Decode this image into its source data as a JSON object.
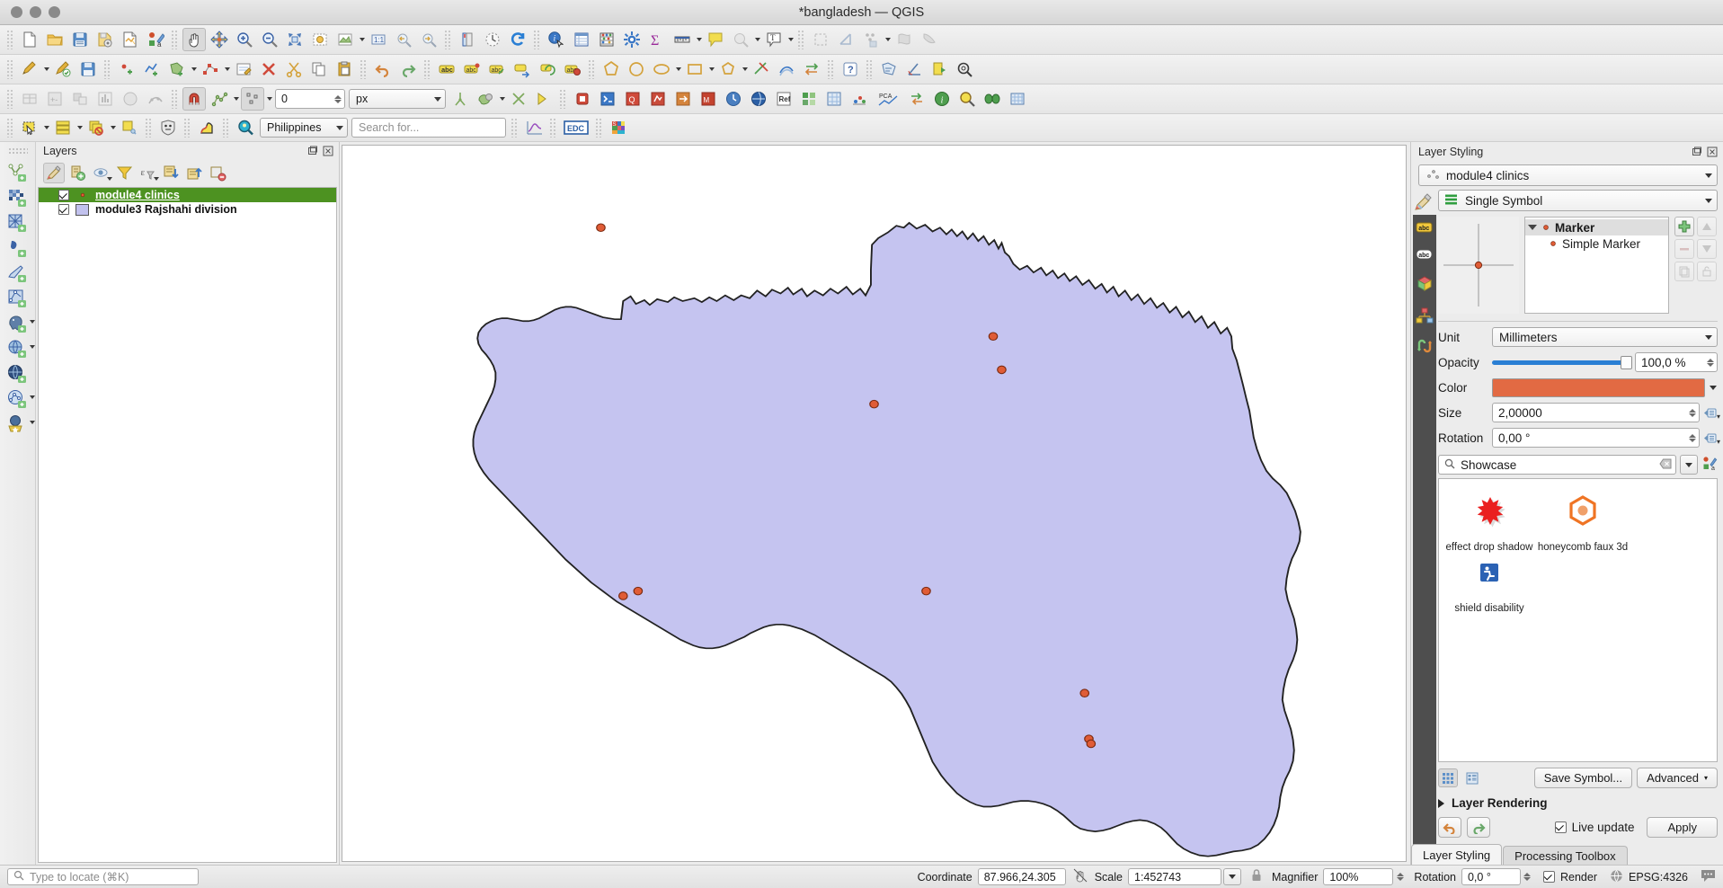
{
  "window": {
    "title": "*bangladesh — QGIS"
  },
  "toolbars": {
    "row1": [
      {
        "name": "new-project-button",
        "icon": "new-file-icon"
      },
      {
        "name": "open-project-button",
        "icon": "open-folder-icon"
      },
      {
        "name": "save-project-button",
        "icon": "save-disk-icon"
      },
      {
        "name": "save-project-as-button",
        "icon": "save-as-icon"
      },
      {
        "name": "new-print-layout-button",
        "icon": "layout-icon"
      },
      {
        "name": "style-manager-button",
        "icon": "style-manager-icon"
      },
      {
        "name": "pan-map-button",
        "icon": "pan-hand-icon"
      },
      {
        "name": "pan-to-selection-button",
        "icon": "pan-selection-icon"
      },
      {
        "name": "zoom-in-button",
        "icon": "zoom-in-icon"
      },
      {
        "name": "zoom-out-button",
        "icon": "zoom-out-icon"
      },
      {
        "name": "zoom-full-button",
        "icon": "zoom-full-icon"
      },
      {
        "name": "zoom-to-selection-button",
        "icon": "zoom-selection-icon"
      },
      {
        "name": "zoom-to-layer-button",
        "icon": "zoom-layer-icon"
      },
      {
        "name": "zoom-native-button",
        "icon": "zoom-native-icon"
      },
      {
        "name": "zoom-last-button",
        "icon": "zoom-last-icon"
      },
      {
        "name": "zoom-next-button",
        "icon": "zoom-next-icon"
      },
      {
        "name": "new-map-view-button",
        "icon": "map-view-icon"
      },
      {
        "name": "new-3d-map-view-button",
        "icon": "map-3d-icon"
      },
      {
        "name": "refresh-button",
        "icon": "refresh-icon"
      },
      {
        "name": "identify-features-button",
        "icon": "identify-icon"
      },
      {
        "name": "open-attribute-table-button",
        "icon": "attribute-table-icon"
      },
      {
        "name": "field-calculator-button",
        "icon": "abacus-icon"
      },
      {
        "name": "processing-button",
        "icon": "gear-icon"
      },
      {
        "name": "statistical-summary-button",
        "icon": "sigma-icon"
      },
      {
        "name": "measure-line-button",
        "icon": "ruler-icon"
      },
      {
        "name": "map-tips-button",
        "icon": "maptips-icon"
      },
      {
        "name": "show-pinned-labels-button",
        "icon": "pinned-labels-icon"
      },
      {
        "name": "new-text-annotation-button",
        "icon": "text-annotation-icon"
      },
      {
        "name": "select-features-button",
        "icon": "select-dashed-icon"
      },
      {
        "name": "deselect-button",
        "icon": "deselect-icon"
      },
      {
        "name": "select-by-value-button",
        "icon": "select-value-icon"
      },
      {
        "name": "select-by-expression-button",
        "icon": "select-expression-icon"
      },
      {
        "name": "invert-selection-button",
        "icon": "invert-selection-icon"
      }
    ],
    "row2": [
      {
        "name": "current-edits-button",
        "icon": "pencil-edits-icon"
      },
      {
        "name": "toggle-editing-button",
        "icon": "toggle-editing-icon"
      },
      {
        "name": "save-layer-edits-button",
        "icon": "save-edits-icon"
      },
      {
        "name": "add-point-feature-button",
        "icon": "add-point-icon"
      },
      {
        "name": "add-line-feature-button",
        "icon": "add-line-icon"
      },
      {
        "name": "add-polygon-feature-button",
        "icon": "add-polygon-icon"
      },
      {
        "name": "vertex-tool-button",
        "icon": "vertex-tool-icon"
      },
      {
        "name": "modify-attributes-button",
        "icon": "modify-attributes-icon"
      },
      {
        "name": "delete-selected-button",
        "icon": "delete-selected-icon"
      },
      {
        "name": "cut-features-button",
        "icon": "scissors-icon"
      },
      {
        "name": "copy-features-button",
        "icon": "copy-icon"
      },
      {
        "name": "paste-features-button",
        "icon": "paste-icon"
      },
      {
        "name": "undo-button",
        "icon": "undo-icon"
      },
      {
        "name": "redo-button",
        "icon": "redo-icon"
      },
      {
        "name": "label-toolbar-button",
        "icon": "abc-label-icon"
      },
      {
        "name": "pin-labels-button",
        "icon": "pin-labels-icon"
      },
      {
        "name": "show-hide-labels-button",
        "icon": "show-labels-icon"
      },
      {
        "name": "move-label-button",
        "icon": "move-label-icon"
      },
      {
        "name": "rotate-label-button",
        "icon": "rotate-label-icon"
      },
      {
        "name": "change-label-button",
        "icon": "change-label-icon"
      },
      {
        "name": "add-polygon-shape-button",
        "icon": "polygon-shape-icon"
      },
      {
        "name": "add-circle-button",
        "icon": "circle-shape-icon"
      },
      {
        "name": "add-ellipse-button",
        "icon": "ellipse-shape-icon"
      },
      {
        "name": "add-rectangle-button",
        "icon": "rectangle-shape-icon"
      },
      {
        "name": "add-regular-polygon-button",
        "icon": "regular-polygon-icon"
      },
      {
        "name": "trim-extend-button",
        "icon": "trim-extend-icon"
      },
      {
        "name": "offset-curve-button",
        "icon": "offset-curve-icon"
      },
      {
        "name": "reverse-line-button",
        "icon": "reverse-line-icon"
      },
      {
        "name": "help-button",
        "icon": "help-icon"
      },
      {
        "name": "measure-area-button",
        "icon": "measure-area-icon"
      },
      {
        "name": "measure-angle-button",
        "icon": "measure-angle-icon"
      },
      {
        "name": "run-feature-action-button",
        "icon": "run-action-icon"
      },
      {
        "name": "show-bookmarks-button",
        "icon": "bookmark-panel-icon"
      }
    ],
    "row3": [
      {
        "name": "georeferencer-button",
        "icon": "georeferencer-icon"
      },
      {
        "name": "raster-calculator-button",
        "icon": "raster-calc-icon"
      },
      {
        "name": "raster-align-button",
        "icon": "raster-align-icon"
      },
      {
        "name": "zonal-statistics-button",
        "icon": "zonal-stats-icon"
      },
      {
        "name": "heatmap-button",
        "icon": "heatmap-icon"
      },
      {
        "name": "interpolation-button",
        "icon": "interpolation-icon"
      },
      {
        "name": "enable-snapping-button",
        "icon": "magnet-icon"
      },
      {
        "name": "snapping-mode-button",
        "icon": "snap-mode-icon"
      },
      {
        "name": "snapping-type-button",
        "icon": "snap-type-icon"
      },
      {
        "name": "topological-editing-button",
        "icon": "topological-icon"
      },
      {
        "name": "avoid-overlap-button",
        "icon": "avoid-overlap-icon"
      },
      {
        "name": "snap-intersections-button",
        "icon": "snap-intersection-icon"
      },
      {
        "name": "self-snapping-button",
        "icon": "self-snap-icon"
      },
      {
        "name": "tracing-button",
        "icon": "tracing-icon"
      },
      {
        "name": "plugin-manager-button",
        "icon": "plugin-icon"
      },
      {
        "name": "python-console-button",
        "icon": "python-icon"
      },
      {
        "name": "qconsolidate-button",
        "icon": "qconsolidate-icon"
      },
      {
        "name": "quickosm-button",
        "icon": "quickosm-icon"
      },
      {
        "name": "qfield-sync-button",
        "icon": "qfield-icon"
      },
      {
        "name": "mmqgis-button",
        "icon": "mmqgis-icon"
      },
      {
        "name": "timemanager-button",
        "icon": "timemanager-icon"
      },
      {
        "name": "refactor-button",
        "icon": "refactor-icon"
      },
      {
        "name": "semi-automatic-classification-button",
        "icon": "sac-icon"
      },
      {
        "name": "dzetsaka-button",
        "icon": "dzetsaka-icon"
      },
      {
        "name": "freehand-raster-button",
        "icon": "freehand-raster-icon"
      },
      {
        "name": "pca-button",
        "icon": "pca-icon"
      },
      {
        "name": "swap-vector-button",
        "icon": "swap-vector-icon"
      },
      {
        "name": "information-button",
        "icon": "info-icon"
      },
      {
        "name": "magnifier-button",
        "icon": "magnifier-glass-icon"
      },
      {
        "name": "mask-button",
        "icon": "mask-icon"
      },
      {
        "name": "grid-tool-button",
        "icon": "grid-tool-icon"
      }
    ],
    "snapping": {
      "tolerance_value": "0",
      "unit_label": "px"
    },
    "attributes": {
      "select_label": "",
      "place_combo_label": "Philippines",
      "search_placeholder": "Search for...",
      "buttons": [
        {
          "name": "select-features-dropdown-button",
          "icon": "select-rect-icon"
        },
        {
          "name": "open-attribute-table-button",
          "icon": "table-rows-icon"
        },
        {
          "name": "deselect-all-button",
          "icon": "deselect-layers-icon"
        },
        {
          "name": "select-value-button",
          "icon": "select-tag-icon"
        },
        {
          "name": "mask-plugin-button",
          "icon": "mask-shield-icon"
        },
        {
          "name": "profile-tool-button",
          "icon": "profile-curve-icon"
        },
        {
          "name": "geocoding-button",
          "icon": "magnifier-pin-icon"
        },
        {
          "name": "plot-button",
          "icon": "plot-curve-icon"
        },
        {
          "name": "edc-browser-button",
          "icon": "edc-icon"
        },
        {
          "name": "sld-styles-button",
          "icon": "sld-colors-icon"
        }
      ]
    }
  },
  "vertical_toolbar": [
    {
      "name": "new-geopackage-layer-button",
      "icon": "new-geopackage-icon"
    },
    {
      "name": "new-shapefile-layer-button",
      "icon": "new-shapefile-icon"
    },
    {
      "name": "new-spatialite-layer-button",
      "icon": "new-spatialite-icon"
    },
    {
      "name": "new-geopackage-layer2-button",
      "icon": "new-mesh-icon"
    },
    {
      "name": "new-temp-scratch-layer-button",
      "icon": "new-scratch-icon"
    },
    {
      "name": "add-vector-layer-button",
      "icon": "add-vector-icon"
    },
    {
      "name": "add-raster-layer-button",
      "icon": "add-raster-icon"
    },
    {
      "name": "add-delimited-text-layer-button",
      "icon": "add-delimited-text-icon"
    },
    {
      "name": "add-postgis-layer-button",
      "icon": "add-postgis-elephant-icon"
    },
    {
      "name": "add-wms-layer-button",
      "icon": "add-wms-globe-icon"
    },
    {
      "name": "add-wfs-layer-button",
      "icon": "add-wfs-globe-icon"
    },
    {
      "name": "add-vector-tile-layer-button",
      "icon": "add-vector-tile-icon"
    },
    {
      "name": "add-xyz-layer-button",
      "icon": "add-xyz-icon"
    }
  ],
  "layers_panel": {
    "title": "Layers",
    "toolbar_buttons": [
      {
        "name": "open-layer-styling-button",
        "icon": "paintbrush-icon"
      },
      {
        "name": "add-group-button",
        "icon": "add-group-icon"
      },
      {
        "name": "manage-layer-visibility-button",
        "icon": "eye-icon"
      },
      {
        "name": "filter-legend-button",
        "icon": "filter-funnel-icon"
      },
      {
        "name": "filter-legend-expression-button",
        "icon": "epsilon-filter-icon"
      },
      {
        "name": "expand-all-button",
        "icon": "expand-all-icon"
      },
      {
        "name": "collapse-all-button",
        "icon": "collapse-all-icon"
      },
      {
        "name": "remove-layer-button",
        "icon": "remove-layer-icon"
      }
    ],
    "layers": [
      {
        "name": "module4 clinics",
        "checked": true,
        "selected": true,
        "symbol": "point",
        "symbol_color": "#e05c36"
      },
      {
        "name": "module3 Rajshahi division",
        "checked": true,
        "selected": false,
        "symbol": "polygon",
        "symbol_color": "#c2c2ee"
      }
    ]
  },
  "map": {
    "polygon_fill": "#c5c4f0",
    "polygon_stroke": "#222222",
    "point_color": "#e05c36",
    "point_stroke": "#7a2a10",
    "points": [
      {
        "x": 0.243,
        "y": 0.114
      },
      {
        "x": 0.612,
        "y": 0.267
      },
      {
        "x": 0.62,
        "y": 0.313
      },
      {
        "x": 0.5,
        "y": 0.361
      },
      {
        "x": 0.268,
        "y": 0.63
      },
      {
        "x": 0.277,
        "y": 0.623
      },
      {
        "x": 0.549,
        "y": 0.623
      },
      {
        "x": 0.698,
        "y": 0.765
      },
      {
        "x": 0.702,
        "y": 0.831
      },
      {
        "x": 0.704,
        "y": 0.834
      }
    ]
  },
  "layer_styling": {
    "title": "Layer Styling",
    "layer_combo": "module4 clinics",
    "renderer_combo": "Single Symbol",
    "symbol_tree": [
      {
        "label": "Marker",
        "level": 0
      },
      {
        "label": "Simple Marker",
        "level": 1
      }
    ],
    "symbol_buttons": [
      {
        "name": "add-symbol-layer-button",
        "icon": "plus-green-icon",
        "disabled": false
      },
      {
        "name": "move-symbol-up-button",
        "icon": "arrow-up-icon",
        "disabled": true
      },
      {
        "name": "remove-symbol-layer-button",
        "icon": "minus-icon",
        "disabled": true
      },
      {
        "name": "move-symbol-down-button",
        "icon": "arrow-down-icon",
        "disabled": true
      },
      {
        "name": "duplicate-symbol-layer-button",
        "icon": "duplicate-icon",
        "disabled": true
      },
      {
        "name": "lock-symbol-color-button",
        "icon": "lock-icon",
        "disabled": true
      }
    ],
    "side_tabs": [
      {
        "name": "symbology-tab",
        "icon": "paintbrush-icon"
      },
      {
        "name": "labels-tab",
        "icon": "abc-yellow-icon"
      },
      {
        "name": "masks-tab",
        "icon": "abc-white-icon"
      },
      {
        "name": "3d-view-tab",
        "icon": "cube-icon"
      },
      {
        "name": "diagrams-tab",
        "icon": "diagram-icon"
      },
      {
        "name": "actions-tab",
        "icon": "actions-arrows-icon"
      }
    ],
    "fields": {
      "unit_label": "Unit",
      "unit_value": "Millimeters",
      "opacity_label": "Opacity",
      "opacity_value": "100,0 %",
      "opacity_pct": 100,
      "color_label": "Color",
      "color_value": "#e26a43",
      "size_label": "Size",
      "size_value": "2,00000",
      "rotation_label": "Rotation",
      "rotation_value": "0,00 °"
    },
    "showcase": {
      "search_value": "Showcase",
      "items": [
        {
          "label": "effect drop shadow",
          "icon": "red-starburst-icon"
        },
        {
          "label": "honeycomb faux 3d",
          "icon": "orange-hexagon-icon"
        },
        {
          "label": "shield disability",
          "icon": "blue-accessibility-icon"
        }
      ]
    },
    "view_buttons": [
      {
        "name": "icon-view-button",
        "icon": "grid-view-icon",
        "active": true
      },
      {
        "name": "list-view-button",
        "icon": "list-view-icon",
        "active": false
      }
    ],
    "save_symbol_label": "Save Symbol...",
    "advanced_label": "Advanced",
    "layer_rendering_label": "Layer Rendering",
    "live_update_label": "Live update",
    "live_update_checked": true,
    "apply_label": "Apply",
    "undo_button_name": "undo-style-button",
    "redo_button_name": "redo-style-button",
    "tabs": [
      {
        "label": "Layer Styling",
        "active": true
      },
      {
        "label": "Processing Toolbox",
        "active": false
      }
    ]
  },
  "status_bar": {
    "locate_placeholder": "Type to locate (⌘K)",
    "coordinate_label": "Coordinate",
    "coordinate_value": "87.966,24.305",
    "scale_label": "Scale",
    "scale_value": "1:452743",
    "magnifier_label": "Magnifier",
    "magnifier_value": "100%",
    "rotation_label": "Rotation",
    "rotation_value": "0,0 °",
    "render_label": "Render",
    "render_checked": true,
    "crs_value": "EPSG:4326",
    "messages_icon": "message-bubble-icon"
  }
}
